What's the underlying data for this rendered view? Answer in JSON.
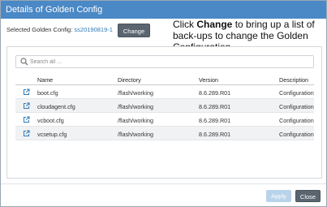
{
  "dialog": {
    "title": "Details of Golden Config",
    "config_label": "Selected Golden Config:",
    "config_value": "ss20190819-1",
    "change_label": "Change",
    "callout": {
      "prefix": "Click ",
      "bold": "Change",
      "suffix": " to bring up a list of back-ups to change the Golden Configuration."
    },
    "search": {
      "placeholder": "Search all ..."
    },
    "table": {
      "columns": [
        "Name",
        "Directory",
        "Version",
        "Description"
      ],
      "rows": [
        {
          "name": "boot.cfg",
          "directory": "/flash/working",
          "version": "8.6.289.R01",
          "description": "Configuration"
        },
        {
          "name": "cloudagent.cfg",
          "directory": "/flash/working",
          "version": "8.6.289.R01",
          "description": "Configuration"
        },
        {
          "name": "vcboot.cfg",
          "directory": "/flash/working",
          "version": "8.6.289.R01",
          "description": "Configuration"
        },
        {
          "name": "vcsetup.cfg",
          "directory": "/flash/working",
          "version": "8.6.289.R01",
          "description": "Configuration"
        }
      ]
    },
    "apply_label": "Apply",
    "close_label": "Close"
  },
  "colors": {
    "titlebar": "#4a88c6",
    "link": "#2f7ab8",
    "button_dark": "#5a6570",
    "button_disabled": "#b9d3ea"
  },
  "icons": {
    "row_action": "external-link-icon",
    "search": "search-icon"
  }
}
